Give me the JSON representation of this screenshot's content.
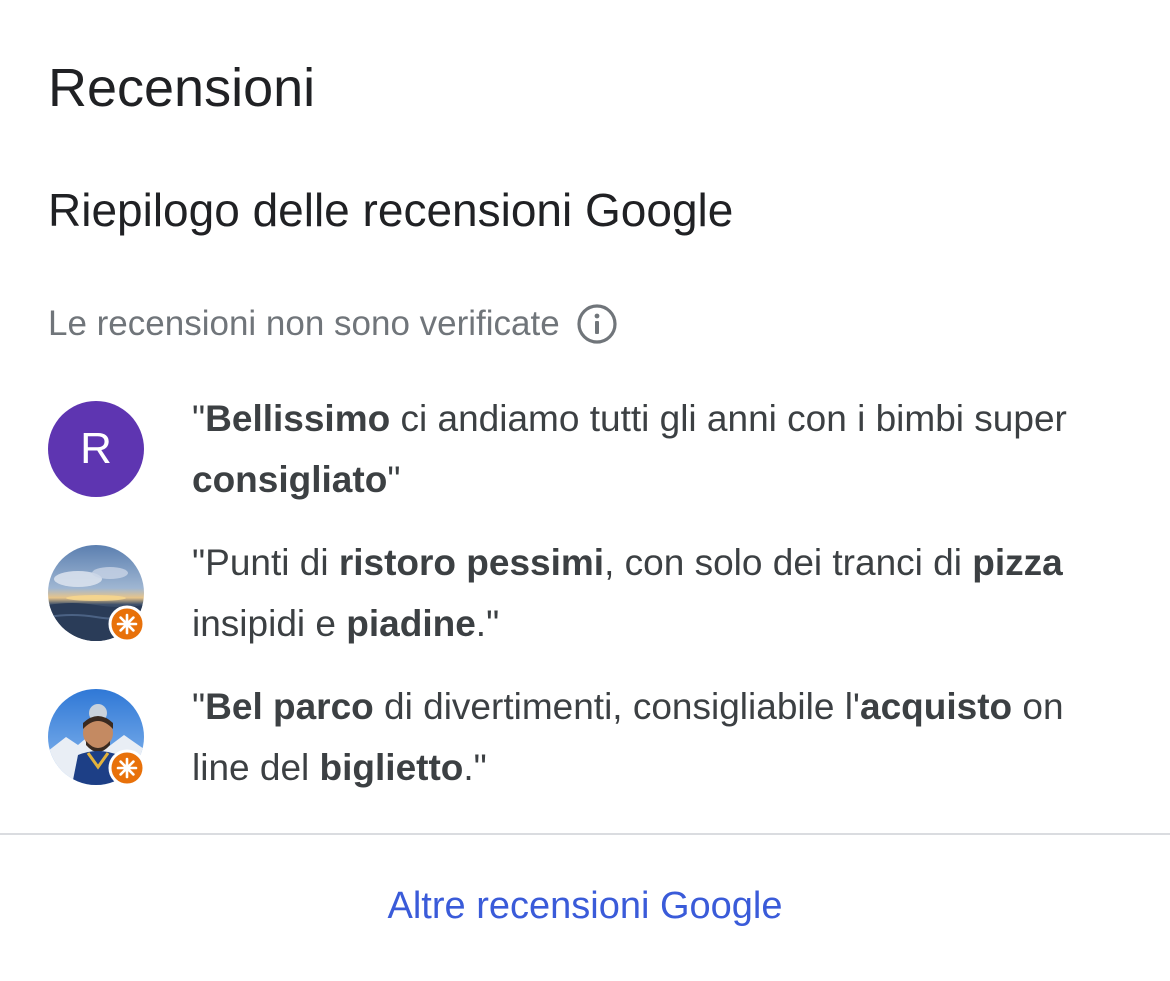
{
  "header": {
    "title": "Recensioni",
    "subtitle": "Riepilogo delle recensioni Google"
  },
  "notice": {
    "text": "Le recensioni non sono verificate",
    "icon": "info-icon"
  },
  "reviews": [
    {
      "avatar": {
        "type": "letter",
        "letter": "R",
        "color": "#5e35b1",
        "badge": false
      },
      "segments": [
        {
          "text": "\"",
          "bold": false
        },
        {
          "text": "Bellissimo",
          "bold": true
        },
        {
          "text": " ci andiamo tutti gli anni con i bimbi super ",
          "bold": false
        },
        {
          "text": "consigliato",
          "bold": true
        },
        {
          "text": "\"",
          "bold": false
        }
      ]
    },
    {
      "avatar": {
        "type": "photo",
        "photo": "sunset-sea-photo",
        "badge": true,
        "badge_color": "#e8710a"
      },
      "segments": [
        {
          "text": "\"Punti di ",
          "bold": false
        },
        {
          "text": "ristoro pessimi",
          "bold": true
        },
        {
          "text": ", con solo dei tranci di ",
          "bold": false
        },
        {
          "text": "pizza",
          "bold": true
        },
        {
          "text": " insipidi e ",
          "bold": false
        },
        {
          "text": "piadine",
          "bold": true
        },
        {
          "text": ".\"",
          "bold": false
        }
      ]
    },
    {
      "avatar": {
        "type": "photo",
        "photo": "ski-selfie-photo",
        "badge": true,
        "badge_color": "#e8710a"
      },
      "segments": [
        {
          "text": "\"",
          "bold": false
        },
        {
          "text": "Bel parco",
          "bold": true
        },
        {
          "text": " di divertimenti, consigliabile l'",
          "bold": false
        },
        {
          "text": "acquisto",
          "bold": true
        },
        {
          "text": " on line del ",
          "bold": false
        },
        {
          "text": "biglietto",
          "bold": true
        },
        {
          "text": ".\"",
          "bold": false
        }
      ]
    }
  ],
  "footer": {
    "more_link": "Altre recensioni Google",
    "link_color": "#3a5bd9"
  }
}
